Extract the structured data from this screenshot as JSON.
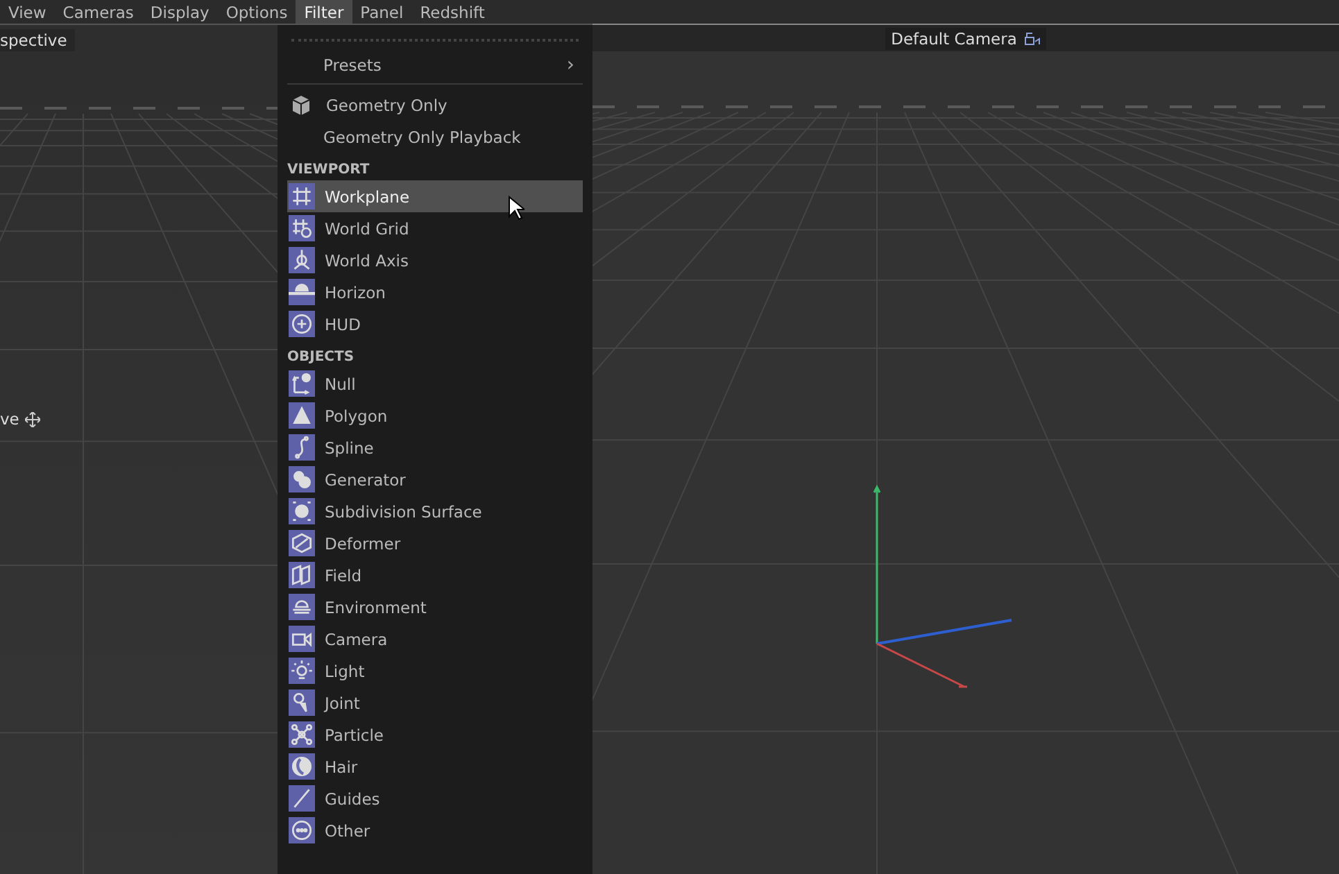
{
  "menu_bar": [
    {
      "label": "View",
      "selected": false
    },
    {
      "label": "Cameras",
      "selected": false
    },
    {
      "label": "Display",
      "selected": false
    },
    {
      "label": "Options",
      "selected": false
    },
    {
      "label": "Filter",
      "selected": true
    },
    {
      "label": "Panel",
      "selected": false
    },
    {
      "label": "Redshift",
      "selected": false
    }
  ],
  "left_viewport": {
    "title": "spective",
    "tool_label": "ve"
  },
  "right_viewport": {
    "camera": "Default Camera"
  },
  "filter_menu": [
    {
      "kind": "tearoff"
    },
    {
      "kind": "submenu",
      "label": "Presets",
      "arrow": "›"
    },
    {
      "kind": "separator"
    },
    {
      "kind": "plain",
      "label": "Geometry Only",
      "icon": true
    },
    {
      "kind": "plain",
      "label": "Geometry Only Playback",
      "icon": false
    },
    {
      "kind": "header",
      "label": "VIEWPORT"
    },
    {
      "kind": "item",
      "label": "Workplane",
      "highlighted": true
    },
    {
      "kind": "item",
      "label": "World Grid",
      "highlighted": false
    },
    {
      "kind": "item",
      "label": "World Axis",
      "highlighted": false
    },
    {
      "kind": "item",
      "label": "Horizon",
      "highlighted": false
    },
    {
      "kind": "item",
      "label": "HUD",
      "highlighted": false
    },
    {
      "kind": "header",
      "label": "OBJECTS"
    },
    {
      "kind": "item",
      "label": "Null",
      "highlighted": false
    },
    {
      "kind": "item",
      "label": "Polygon",
      "highlighted": false
    },
    {
      "kind": "item",
      "label": "Spline",
      "highlighted": false
    },
    {
      "kind": "item",
      "label": "Generator",
      "highlighted": false
    },
    {
      "kind": "item",
      "label": "Subdivision Surface",
      "highlighted": false
    },
    {
      "kind": "item",
      "label": "Deformer",
      "highlighted": false
    },
    {
      "kind": "item",
      "label": "Field",
      "highlighted": false
    },
    {
      "kind": "item",
      "label": "Environment",
      "highlighted": false
    },
    {
      "kind": "item",
      "label": "Camera",
      "highlighted": false
    },
    {
      "kind": "item",
      "label": "Light",
      "highlighted": false
    },
    {
      "kind": "item",
      "label": "Joint",
      "highlighted": false
    },
    {
      "kind": "item",
      "label": "Particle",
      "highlighted": false
    },
    {
      "kind": "item",
      "label": "Hair",
      "highlighted": false
    },
    {
      "kind": "item",
      "label": "Guides",
      "highlighted": false
    },
    {
      "kind": "item",
      "label": "Other",
      "highlighted": false
    }
  ]
}
